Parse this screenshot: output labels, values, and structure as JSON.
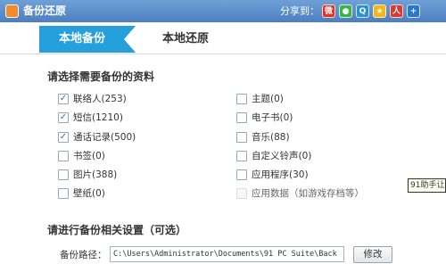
{
  "window": {
    "title": "备份还原"
  },
  "share": {
    "label": "分享到：",
    "icons": [
      "weibo-icon",
      "wechat-icon",
      "qq-icon",
      "qzone-icon",
      "renren-icon",
      "more-share-icon"
    ]
  },
  "tabs": [
    {
      "label": "本地备份",
      "active": true
    },
    {
      "label": "本地还原",
      "active": false
    }
  ],
  "select_section": {
    "title": "请选择需要备份的资料"
  },
  "options_left": [
    {
      "label": "联络人(253)",
      "checked": true
    },
    {
      "label": "短信(1210)",
      "checked": true
    },
    {
      "label": "通话记录(500)",
      "checked": true
    },
    {
      "label": "书签(0)",
      "checked": false
    },
    {
      "label": "图片(388)",
      "checked": false
    },
    {
      "label": "壁纸(0)",
      "checked": false
    }
  ],
  "options_right": [
    {
      "label": "主题(0)",
      "checked": false,
      "disabled": false
    },
    {
      "label": "电子书(0)",
      "checked": false,
      "disabled": false
    },
    {
      "label": "音乐(88)",
      "checked": false,
      "disabled": false
    },
    {
      "label": "自定义铃声(0)",
      "checked": false,
      "disabled": false
    },
    {
      "label": "应用程序(30)",
      "checked": false,
      "disabled": false
    },
    {
      "label": "应用数据（如游戏存档等）",
      "checked": false,
      "disabled": true
    }
  ],
  "settings_section": {
    "title": "请进行备份相关设置（可选）"
  },
  "backup_path": {
    "label": "备份路径：",
    "value": "C:\\Users\\Administrator\\Documents\\91 PC Suite\\Back",
    "modify_label": "修改"
  },
  "tooltip": {
    "text": "91助手让"
  },
  "colors": {
    "accent": "#25a0dc",
    "titlebar": "#4d7fc0"
  }
}
